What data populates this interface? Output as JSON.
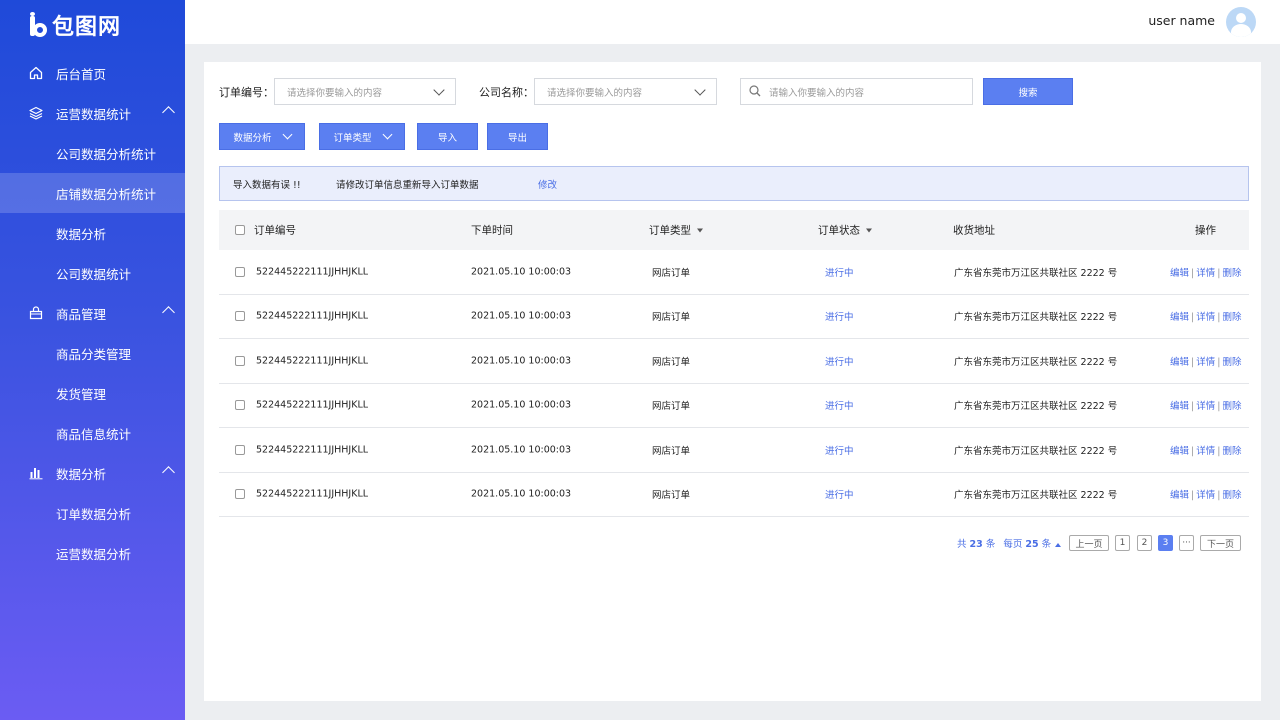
{
  "brand": {
    "name": "包图网"
  },
  "user": {
    "name": "user name"
  },
  "sidebar": {
    "groups": [
      {
        "label": "后台首页",
        "icon": "home-icon"
      },
      {
        "label": "运营数据统计",
        "icon": "layers-icon",
        "items": [
          "公司数据分析统计",
          "店铺数据分析统计",
          "数据分析",
          "公司数据统计"
        ]
      },
      {
        "label": "商品管理",
        "icon": "bag-icon",
        "items": [
          "商品分类管理",
          "发货管理",
          "商品信息统计"
        ]
      },
      {
        "label": "数据分析",
        "icon": "bar-chart-icon",
        "items": [
          "订单数据分析",
          "运营数据分析"
        ]
      }
    ],
    "active": "店铺数据分析统计"
  },
  "filters": {
    "order_no_label": "订单编号：",
    "order_no_placeholder": "请选择你要输入的内容",
    "company_label": "公司名称：",
    "company_placeholder": "请选择你要输入的内容",
    "search_placeholder": "请输入你要输入的内容",
    "search_button": "搜索"
  },
  "actions": {
    "data_analysis": "数据分析",
    "order_type": "订单类型",
    "import": "导入",
    "export": "导出"
  },
  "alert": {
    "title": "导入数据有误 !!",
    "message": "请修改订单信息重新导入订单数据",
    "link": "修改"
  },
  "table": {
    "headers": {
      "order_no": "订单编号",
      "order_time": "下单时间",
      "order_type": "订单类型",
      "order_status": "订单状态",
      "address": "收货地址",
      "operations": "操作"
    },
    "rows": [
      {
        "order_no": "522445222111JJHHJKLL",
        "time": "2021.05.10 10:00:03",
        "type": "网店订单",
        "status": "进行中",
        "address": "广东省东莞市万江区共联社区 2222 号"
      },
      {
        "order_no": "522445222111JJHHJKLL",
        "time": "2021.05.10 10:00:03",
        "type": "网店订单",
        "status": "进行中",
        "address": "广东省东莞市万江区共联社区 2222 号"
      },
      {
        "order_no": "522445222111JJHHJKLL",
        "time": "2021.05.10 10:00:03",
        "type": "网店订单",
        "status": "进行中",
        "address": "广东省东莞市万江区共联社区 2222 号"
      },
      {
        "order_no": "522445222111JJHHJKLL",
        "time": "2021.05.10 10:00:03",
        "type": "网店订单",
        "status": "进行中",
        "address": "广东省东莞市万江区共联社区 2222 号"
      },
      {
        "order_no": "522445222111JJHHJKLL",
        "time": "2021.05.10 10:00:03",
        "type": "网店订单",
        "status": "进行中",
        "address": "广东省东莞市万江区共联社区 2222 号"
      },
      {
        "order_no": "522445222111JJHHJKLL",
        "time": "2021.05.10 10:00:03",
        "type": "网店订单",
        "status": "进行中",
        "address": "广东省东莞市万江区共联社区 2222 号"
      }
    ],
    "row_ops": {
      "edit": "编辑",
      "detail": "详情",
      "delete": "删除",
      "sep": "|"
    }
  },
  "pagination": {
    "total_prefix": "共",
    "total": "23",
    "total_suffix": "条",
    "per_page_prefix": "每页",
    "per_page": "25",
    "per_page_suffix": "条",
    "prev": "上一页",
    "pages": [
      "1",
      "2",
      "3"
    ],
    "current": "3",
    "ellipsis": "···",
    "next": "下一页"
  },
  "colors": {
    "accent": "#5b7ff1",
    "link": "#4a6ee5"
  }
}
